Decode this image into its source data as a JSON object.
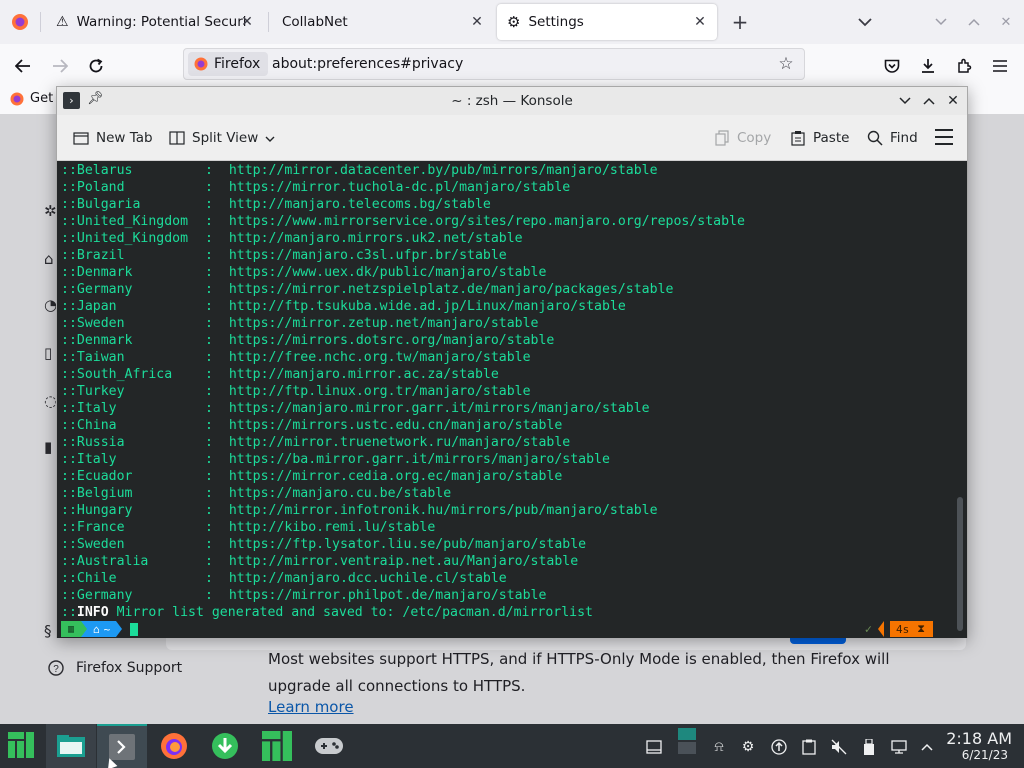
{
  "firefox": {
    "tabs": [
      {
        "title": "Warning: Potential Security Risk Ahead",
        "icon": "warning-icon",
        "active": false
      },
      {
        "title": "CollabNet",
        "icon": "none",
        "active": false
      },
      {
        "title": "Settings",
        "icon": "gear-icon",
        "active": true
      }
    ],
    "identity_label": "Firefox",
    "url": "about:preferences#privacy",
    "bookmark_label": "Get"
  },
  "settings_page": {
    "support_label": "Firefox Support",
    "body_text": "Most websites support HTTPS, and if HTTPS-Only Mode is enabled, then Firefox will upgrade all connections to HTTPS.",
    "learn_more": "Learn more"
  },
  "konsole": {
    "title": "~ : zsh — Konsole",
    "toolbar": {
      "new_tab": "New Tab",
      "split_view": "Split View",
      "copy": "Copy",
      "paste": "Paste",
      "find": "Find"
    },
    "mirrors": [
      {
        "country": "Belarus",
        "url": "http://mirror.datacenter.by/pub/mirrors/manjaro/stable"
      },
      {
        "country": "Poland",
        "url": "https://mirror.tuchola-dc.pl/manjaro/stable"
      },
      {
        "country": "Bulgaria",
        "url": "http://manjaro.telecoms.bg/stable"
      },
      {
        "country": "United_Kingdom",
        "url": "https://www.mirrorservice.org/sites/repo.manjaro.org/repos/stable"
      },
      {
        "country": "United_Kingdom",
        "url": "http://manjaro.mirrors.uk2.net/stable"
      },
      {
        "country": "Brazil",
        "url": "https://manjaro.c3sl.ufpr.br/stable"
      },
      {
        "country": "Denmark",
        "url": "https://www.uex.dk/public/manjaro/stable"
      },
      {
        "country": "Germany",
        "url": "https://mirror.netzspielplatz.de/manjaro/packages/stable"
      },
      {
        "country": "Japan",
        "url": "http://ftp.tsukuba.wide.ad.jp/Linux/manjaro/stable"
      },
      {
        "country": "Sweden",
        "url": "https://mirror.zetup.net/manjaro/stable"
      },
      {
        "country": "Denmark",
        "url": "https://mirrors.dotsrc.org/manjaro/stable"
      },
      {
        "country": "Taiwan",
        "url": "http://free.nchc.org.tw/manjaro/stable"
      },
      {
        "country": "South_Africa",
        "url": "http://manjaro.mirror.ac.za/stable"
      },
      {
        "country": "Turkey",
        "url": "http://ftp.linux.org.tr/manjaro/stable"
      },
      {
        "country": "Italy",
        "url": "https://manjaro.mirror.garr.it/mirrors/manjaro/stable"
      },
      {
        "country": "China",
        "url": "https://mirrors.ustc.edu.cn/manjaro/stable"
      },
      {
        "country": "Russia",
        "url": "http://mirror.truenetwork.ru/manjaro/stable"
      },
      {
        "country": "Italy",
        "url": "https://ba.mirror.garr.it/mirrors/manjaro/stable"
      },
      {
        "country": "Ecuador",
        "url": "https://mirror.cedia.org.ec/manjaro/stable"
      },
      {
        "country": "Belgium",
        "url": "https://manjaro.cu.be/stable"
      },
      {
        "country": "Hungary",
        "url": "http://mirror.infotronik.hu/mirrors/pub/manjaro/stable"
      },
      {
        "country": "France",
        "url": "http://kibo.remi.lu/stable"
      },
      {
        "country": "Sweden",
        "url": "https://ftp.lysator.liu.se/pub/manjaro/stable"
      },
      {
        "country": "Australia",
        "url": "http://mirror.ventraip.net.au/Manjaro/stable"
      },
      {
        "country": "Chile",
        "url": "http://manjaro.dcc.uchile.cl/stable"
      },
      {
        "country": "Germany",
        "url": "https://mirror.philpot.de/manjaro/stable"
      }
    ],
    "info_tag": "INFO",
    "info_message": "Mirror list generated and saved to: /etc/pacman.d/mirrorlist",
    "prompt_dir": "~",
    "elapsed": "4s"
  },
  "taskbar": {
    "time": "2:18 AM",
    "date": "6/21/23"
  },
  "colors": {
    "terminal_bg": "#232627",
    "terminal_fg": "#1cdc9a",
    "prompt_green": "#35bf5c",
    "prompt_blue": "#1d99f3",
    "prompt_orange": "#f67400",
    "taskbar_bg": "#2b3035",
    "accent_teal": "#1b9f91"
  }
}
